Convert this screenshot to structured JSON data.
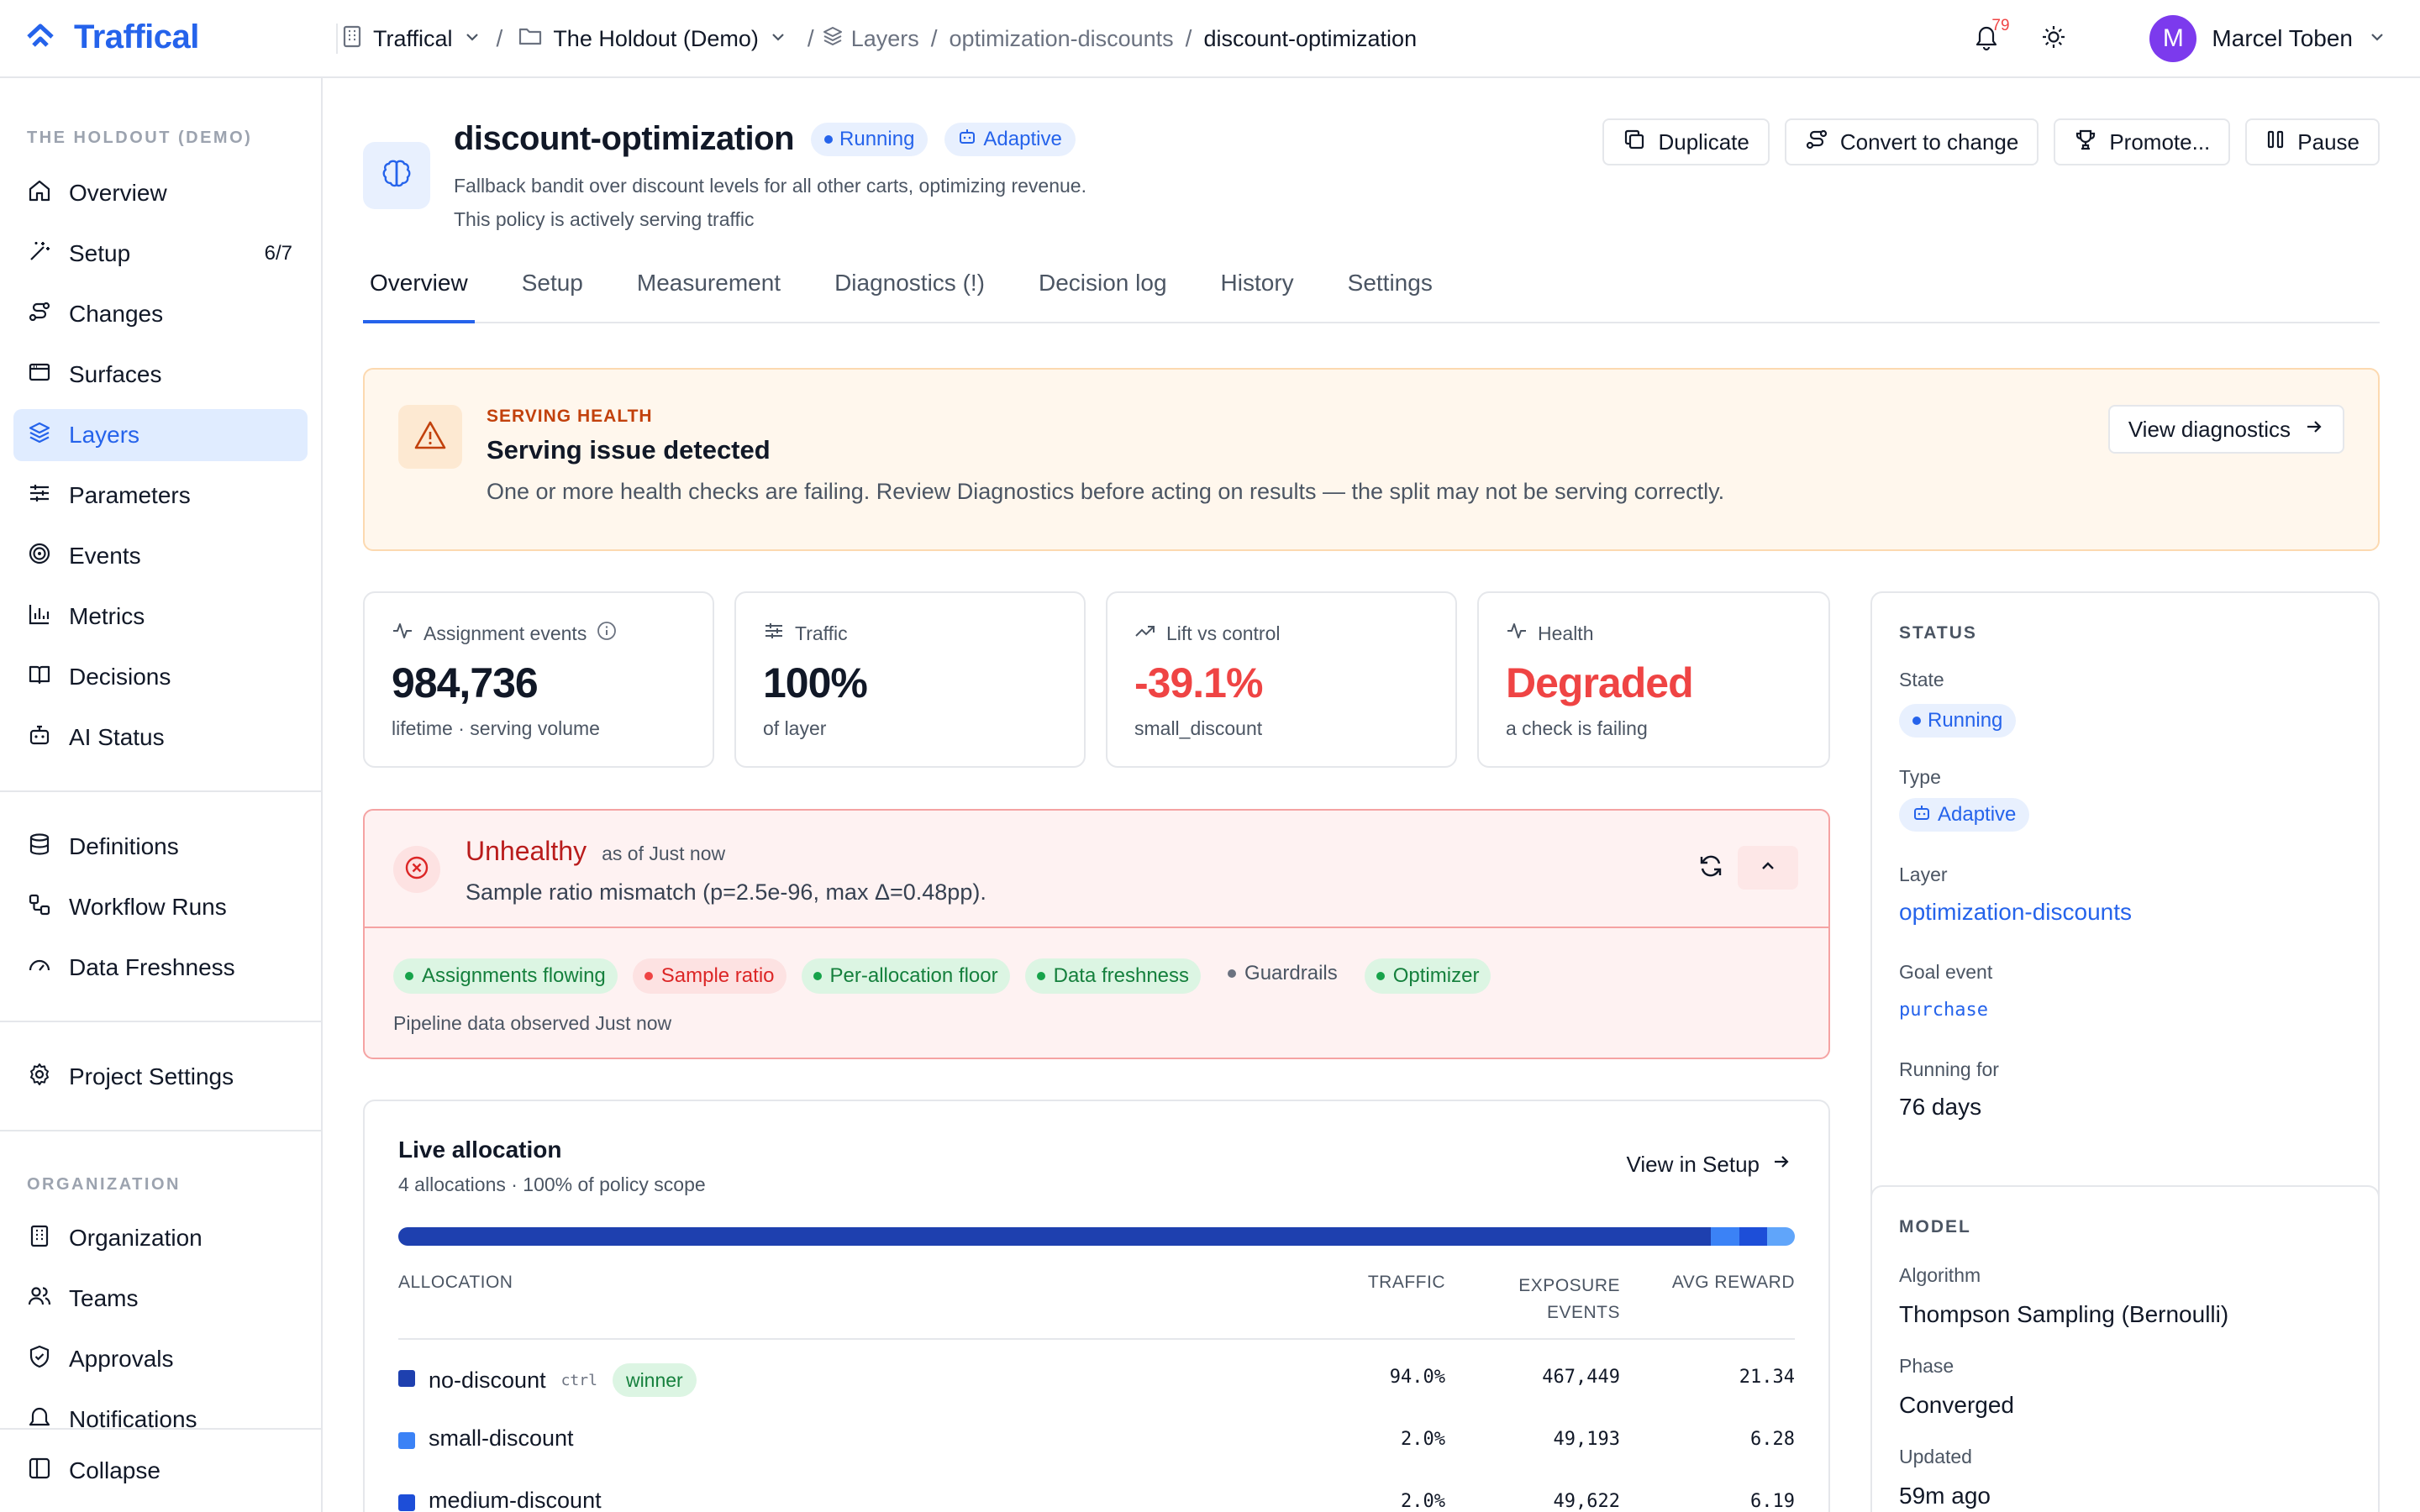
{
  "app": {
    "brand": "Traffical"
  },
  "breadcrumb": {
    "org": "Traffical",
    "project": "The Holdout (Demo)",
    "layers": "Layers",
    "layer": "optimization-discounts",
    "current": "discount-optimization"
  },
  "topbar": {
    "notification_count": "79",
    "user_initial": "M",
    "user_name": "Marcel Toben"
  },
  "sidebar": {
    "section_project": "THE HOLDOUT (DEMO)",
    "items": [
      {
        "label": "Overview",
        "icon": "home-icon"
      },
      {
        "label": "Setup",
        "icon": "wand-icon",
        "count": "6/7"
      },
      {
        "label": "Changes",
        "icon": "route-icon"
      },
      {
        "label": "Surfaces",
        "icon": "window-icon"
      },
      {
        "label": "Layers",
        "icon": "layers-icon",
        "active": true
      },
      {
        "label": "Parameters",
        "icon": "sliders-icon"
      },
      {
        "label": "Events",
        "icon": "target-icon"
      },
      {
        "label": "Metrics",
        "icon": "bar-chart-icon"
      },
      {
        "label": "Decisions",
        "icon": "book-icon"
      },
      {
        "label": "AI Status",
        "icon": "bot-icon"
      }
    ],
    "items_data": [
      {
        "label": "Definitions",
        "icon": "database-icon"
      },
      {
        "label": "Workflow Runs",
        "icon": "workflow-icon"
      },
      {
        "label": "Data Freshness",
        "icon": "gauge-icon"
      }
    ],
    "project_settings": "Project Settings",
    "section_org": "ORGANIZATION",
    "items_org": [
      {
        "label": "Organization",
        "icon": "building-icon"
      },
      {
        "label": "Teams",
        "icon": "users-icon"
      },
      {
        "label": "Approvals",
        "icon": "shield-check-icon"
      },
      {
        "label": "Notifications",
        "icon": "bell-icon"
      }
    ],
    "collapse": "Collapse"
  },
  "policy": {
    "title": "discount-optimization",
    "status_badge": "Running",
    "type_badge": "Adaptive",
    "description": "Fallback bandit over discount levels for all other carts, optimizing revenue.",
    "serving_note": "This policy is actively serving traffic"
  },
  "actions": {
    "duplicate": "Duplicate",
    "convert": "Convert to change",
    "promote": "Promote...",
    "pause": "Pause"
  },
  "tabs": [
    "Overview",
    "Setup",
    "Measurement",
    "Diagnostics (!)",
    "Decision log",
    "History",
    "Settings"
  ],
  "serving_health": {
    "eyebrow": "SERVING HEALTH",
    "title": "Serving issue detected",
    "description": "One or more health checks are failing. Review Diagnostics before acting on results — the split may not be serving correctly.",
    "button": "View diagnostics"
  },
  "stats": [
    {
      "label": "Assignment events",
      "value": "984,736",
      "sub": "lifetime · serving volume",
      "icon": "activity-icon"
    },
    {
      "label": "Traffic",
      "value": "100%",
      "sub": "of layer",
      "icon": "sliders-icon"
    },
    {
      "label": "Lift vs control",
      "value": "-39.1%",
      "sub": "small_discount",
      "icon": "trending-up-icon"
    },
    {
      "label": "Health",
      "value": "Degraded",
      "sub": "a check is failing",
      "icon": "activity-icon"
    }
  ],
  "unhealthy": {
    "title": "Unhealthy",
    "as_of": "as of Just now",
    "description": "Sample ratio mismatch (p=2.5e-96, max Δ=0.48pp).",
    "checks": [
      {
        "label": "Assignments flowing",
        "state": "pass"
      },
      {
        "label": "Sample ratio",
        "state": "fail"
      },
      {
        "label": "Per-allocation floor",
        "state": "pass"
      },
      {
        "label": "Data freshness",
        "state": "pass"
      },
      {
        "label": "Guardrails",
        "state": "neutral"
      },
      {
        "label": "Optimizer",
        "state": "pass"
      }
    ],
    "footer": "Pipeline data observed Just now"
  },
  "allocation": {
    "title": "Live allocation",
    "subtitle": "4 allocations · 100% of policy scope",
    "view_link": "View in Setup",
    "headers": {
      "allocation": "ALLOCATION",
      "traffic": "TRAFFIC",
      "exposure_1": "EXPOSURE",
      "exposure_2": "EVENTS",
      "avg_reward": "AVG REWARD"
    },
    "bar_shares": [
      {
        "share": 94.0,
        "color": "#1e40af"
      },
      {
        "share": 2.0,
        "color": "#3b82f6"
      },
      {
        "share": 2.0,
        "color": "#1d4ed8"
      },
      {
        "share": 2.0,
        "color": "#60a5fa"
      }
    ],
    "rows": [
      {
        "name": "no-discount",
        "tag": "ctrl",
        "badge": "winner",
        "color": "#1e40af",
        "traffic": "94.0%",
        "exposure": "467,449",
        "reward": "21.34"
      },
      {
        "name": "small-discount",
        "tag": "",
        "badge": "",
        "color": "#3b82f6",
        "traffic": "2.0%",
        "exposure": "49,193",
        "reward": "6.28"
      },
      {
        "name": "medium-discount",
        "tag": "",
        "badge": "",
        "color": "#1d4ed8",
        "traffic": "2.0%",
        "exposure": "49,622",
        "reward": "6.19"
      }
    ]
  },
  "status_card": {
    "section": "STATUS",
    "state_label": "State",
    "state_value": "Running",
    "type_label": "Type",
    "type_value": "Adaptive",
    "layer_label": "Layer",
    "layer_value": "optimization-discounts",
    "goal_label": "Goal event",
    "goal_value": "purchase",
    "running_label": "Running for",
    "running_value": "76 days"
  },
  "model_card": {
    "section": "MODEL",
    "algorithm_label": "Algorithm",
    "algorithm_value": "Thompson Sampling (Bernoulli)",
    "phase_label": "Phase",
    "phase_value": "Converged",
    "updated_label": "Updated",
    "updated_value": "59m ago"
  },
  "colors": {
    "accent": "#2563eb",
    "danger": "#ef4444",
    "warning_bg": "#fff7ed",
    "success": "#15803d"
  }
}
